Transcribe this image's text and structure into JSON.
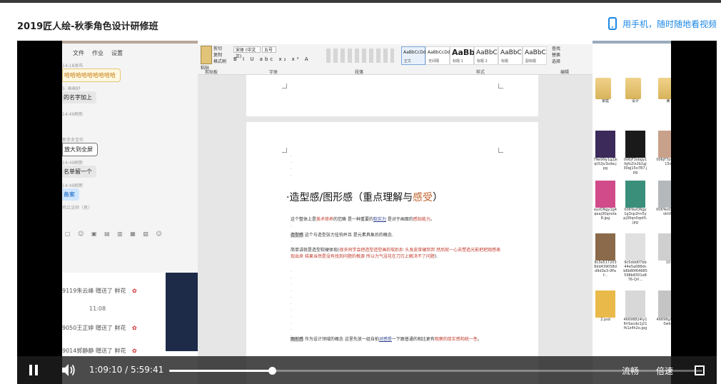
{
  "header": {
    "course_title": "2019匠人绘-秋季角色设计研修班",
    "mobile_watch": "用手机，随时随地看视频"
  },
  "chat": {
    "menu": [
      "文件",
      "作业",
      "设置"
    ],
    "messages": [
      {
        "meta": "14:18发布",
        "text": "哈哈哈哈哈哈哈哈哈",
        "style": "orange"
      },
      {
        "meta": "5: 画画好",
        "text": "的名字加上",
        "style": "gray"
      },
      {
        "meta": "14:49刷新",
        "text": "",
        "style": "none"
      },
      {
        "meta": "新手多宝作",
        "text": "放大到全屏",
        "style": "outline"
      },
      {
        "meta": "14:49刷新",
        "text": "名单留一个",
        "style": "gray"
      },
      {
        "meta": "14:49刷新",
        "text": "备案",
        "style": "blue"
      },
      {
        "meta": "鸡兰法师（男）",
        "text": "",
        "style": "none"
      }
    ],
    "gifts": [
      {
        "user": "9119朱云峰",
        "action": "赠送了 鲜花"
      },
      {
        "user": "9050王芷婷",
        "action": "赠送了 鲜花"
      },
      {
        "user": "9014郭静静",
        "action": "赠送了 鲜花"
      }
    ],
    "time": "11:08",
    "flower_icon": "✿"
  },
  "word": {
    "clipboard": {
      "paste": "粘贴",
      "items": [
        "剪切",
        "复制",
        "格式刷"
      ],
      "label": "剪贴板"
    },
    "font": {
      "name": "宋体 (中文正)",
      "size": "五号",
      "label": "字体",
      "buttons": "B I U abc x₂ x² A"
    },
    "paragraph_label": "段落",
    "styles_label": "样式",
    "styles": [
      {
        "sample": "AaBbCcDd",
        "name": "正文",
        "kind": "small",
        "selected": true
      },
      {
        "sample": "AaBbCcDd",
        "name": "无间隔",
        "kind": "small",
        "selected": false
      },
      {
        "sample": "AaBb",
        "name": "标题 1",
        "kind": "big",
        "selected": false
      },
      {
        "sample": "AaBbC",
        "name": "标题 2",
        "kind": "mid",
        "selected": false
      },
      {
        "sample": "AaBbC",
        "name": "标题",
        "kind": "mid",
        "selected": false
      },
      {
        "sample": "AaBbC",
        "name": "副标题",
        "kind": "mid",
        "selected": false
      }
    ],
    "editing": [
      "查找",
      "替换",
      "选择"
    ],
    "editing_label": "编辑",
    "doc": {
      "heading_prefix": "·造型感/图形感（重点理解与",
      "heading_hl": "感受",
      "heading_suffix": "）",
      "p1": [
        "这个整体上是",
        "美术修养",
        "的范畴  是一种重要的",
        "软实力",
        "  是对于画面的",
        "感知能力",
        "。"
      ],
      "p2": [
        "造型感",
        "  这个与造型张力挂钩并且  是元素具象后的概念."
      ],
      "p3": [
        "简单讲就是造型软硬体现(",
        "很多同学会把造型造型画的软趴趴  头发皮草硬邦邦  然后就一心去塑造光影把把观感表现出来  结果当然是没有找到问题的根源  所以力气没花在刀刃上解决不了问题",
        ")."
      ],
      "p4": [
        "图形感",
        "  作为设计领域的概念  这里先放一组自拍",
        "对感受",
        "一下跟普通的相比更有",
        "观察的厚实感和统一性",
        "。"
      ]
    }
  },
  "explorer": {
    "items": [
      {
        "name": "家庭",
        "type": "folder"
      },
      {
        "name": "设计",
        "type": "folder"
      },
      {
        "name": "美",
        "type": "folder"
      },
      {
        "name": "7Ne9Ny1g2jkqt32jv3sdw.jpg",
        "type": "image",
        "color": "#3b2a5a"
      },
      {
        "name": "006jF3xbgy1fqfo2lx2b1gj30qj15o7B7.jpg",
        "type": "image",
        "color": "#1a1a1a"
      },
      {
        "name": "006jF7p0tgm15o",
        "type": "image",
        "color": "#c9a08a"
      },
      {
        "name": "eyzONgy1g4qeaj30qnota8.jpg",
        "type": "image",
        "color": "#d14b8a"
      },
      {
        "name": "006YezONgy1g3np2hn5ypj30qn0qot5.jpg",
        "type": "image",
        "color": "#3a8f7a"
      },
      {
        "name": "006YezO3zq0okt0k",
        "type": "image",
        "color": "#b5b8bb"
      },
      {
        "name": "9c3e5172038dd439058dd9d3e3-0Paf...",
        "type": "image",
        "color": "#8a6a4a"
      },
      {
        "name": "9c5ddd07bb44e5a088dcb8b80f64685598b8301e876-QrI...",
        "type": "image",
        "color": "#e0e0e0"
      },
      {
        "name": "10",
        "type": "image",
        "color": "#cfcfcf"
      },
      {
        "name": "2.psd",
        "type": "image",
        "color": "#e9b94a"
      },
      {
        "name": "46698824ly16riSacdo1j21fk1z4h2o.jpg",
        "type": "image",
        "color": "#d8d8d8"
      },
      {
        "name": "46698gly5d20wkd",
        "type": "image",
        "color": "#c4c4c4"
      }
    ]
  },
  "player": {
    "current_time": "1:09:10",
    "separator": "/",
    "duration": "5:59:41",
    "progress_fraction": 0.1922,
    "quality": "流畅",
    "speed": "倍速"
  }
}
